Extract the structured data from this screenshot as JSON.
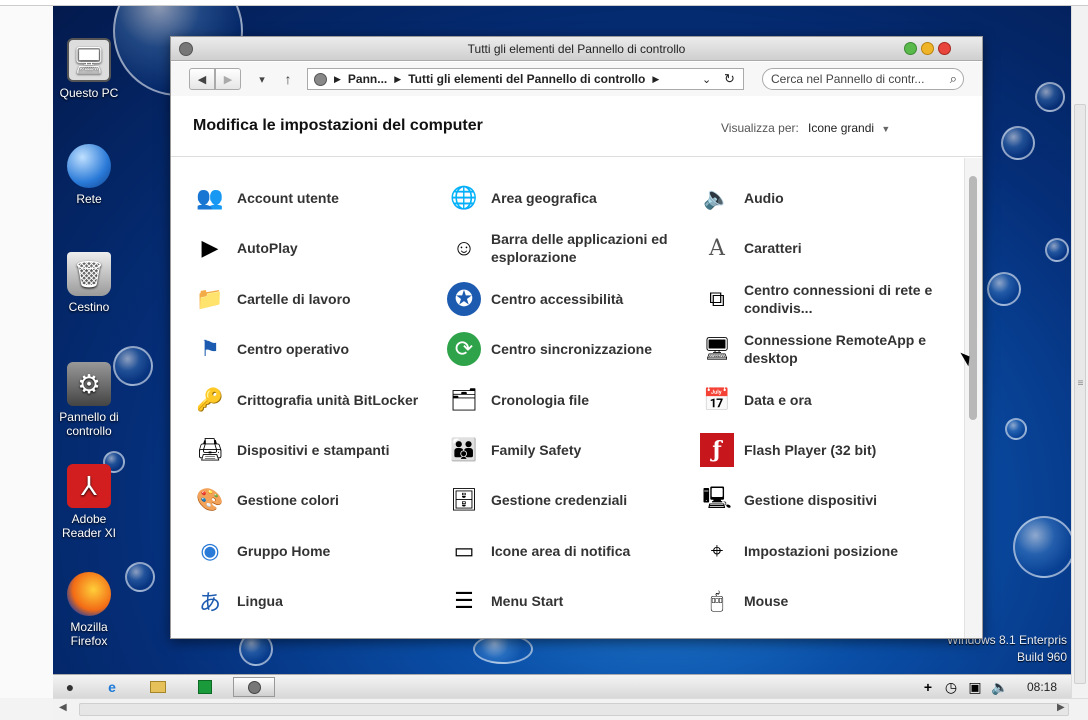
{
  "desktop": {
    "icons": [
      {
        "label": "Questo PC",
        "icon": "computer-icon"
      },
      {
        "label": "Rete",
        "icon": "network-icon"
      },
      {
        "label": "Cestino",
        "icon": "recycle-bin-icon"
      },
      {
        "label": "Pannello di controllo",
        "icon": "control-panel-icon"
      },
      {
        "label": "Adobe Reader XI",
        "icon": "adobe-reader-icon"
      },
      {
        "label": "Mozilla Firefox",
        "icon": "firefox-icon"
      }
    ],
    "watermark_line1": "Windows 8.1 Enterpris",
    "watermark_line2": "Build 960"
  },
  "window": {
    "title": "Tutti gli elementi del Pannello di controllo",
    "breadcrumb": {
      "root": "Pann...",
      "current": "Tutti gli elementi del Pannello di controllo"
    },
    "search_placeholder": "Cerca nel Pannello di contr...",
    "header_title": "Modifica le impostazioni del computer",
    "view_label": "Visualizza per:",
    "view_value": "Icone grandi",
    "items": [
      {
        "label": "Account utente",
        "icon": "users-icon"
      },
      {
        "label": "Area geografica",
        "icon": "globe-clock-icon"
      },
      {
        "label": "Audio",
        "icon": "speaker-icon"
      },
      {
        "label": "AutoPlay",
        "icon": "autoplay-icon"
      },
      {
        "label": "Barra delle applicazioni ed esplorazione",
        "icon": "finder-icon"
      },
      {
        "label": "Caratteri",
        "icon": "fonts-icon"
      },
      {
        "label": "Cartelle di lavoro",
        "icon": "work-folders-icon"
      },
      {
        "label": "Centro accessibilità",
        "icon": "accessibility-icon"
      },
      {
        "label": "Centro connessioni di rete e condivis...",
        "icon": "network-center-icon"
      },
      {
        "label": "Centro operativo",
        "icon": "flag-icon"
      },
      {
        "label": "Centro sincronizzazione",
        "icon": "sync-icon"
      },
      {
        "label": "Connessione RemoteApp e desktop",
        "icon": "remote-app-icon"
      },
      {
        "label": "Crittografia unità BitLocker",
        "icon": "bitlocker-icon"
      },
      {
        "label": "Cronologia file",
        "icon": "file-history-icon"
      },
      {
        "label": "Data e ora",
        "icon": "calendar-clock-icon"
      },
      {
        "label": "Dispositivi e stampanti",
        "icon": "printer-icon"
      },
      {
        "label": "Family Safety",
        "icon": "family-icon"
      },
      {
        "label": "Flash Player (32 bit)",
        "icon": "flash-icon"
      },
      {
        "label": "Gestione colori",
        "icon": "color-management-icon"
      },
      {
        "label": "Gestione credenziali",
        "icon": "credential-vault-icon"
      },
      {
        "label": "Gestione dispositivi",
        "icon": "device-manager-icon"
      },
      {
        "label": "Gruppo Home",
        "icon": "homegroup-icon"
      },
      {
        "label": "Icone area di notifica",
        "icon": "notification-area-icon"
      },
      {
        "label": "Impostazioni posizione",
        "icon": "location-icon"
      },
      {
        "label": "Lingua",
        "icon": "language-icon"
      },
      {
        "label": "Menu Start",
        "icon": "start-menu-icon"
      },
      {
        "label": "Mouse",
        "icon": "mouse-icon"
      }
    ]
  },
  "taskbar": {
    "clock": "08:18"
  },
  "colors": {
    "desktop_blue": "#0a4fa8",
    "close": "#e8453c",
    "minimize": "#f0b429",
    "maximize": "#5ab94b"
  }
}
